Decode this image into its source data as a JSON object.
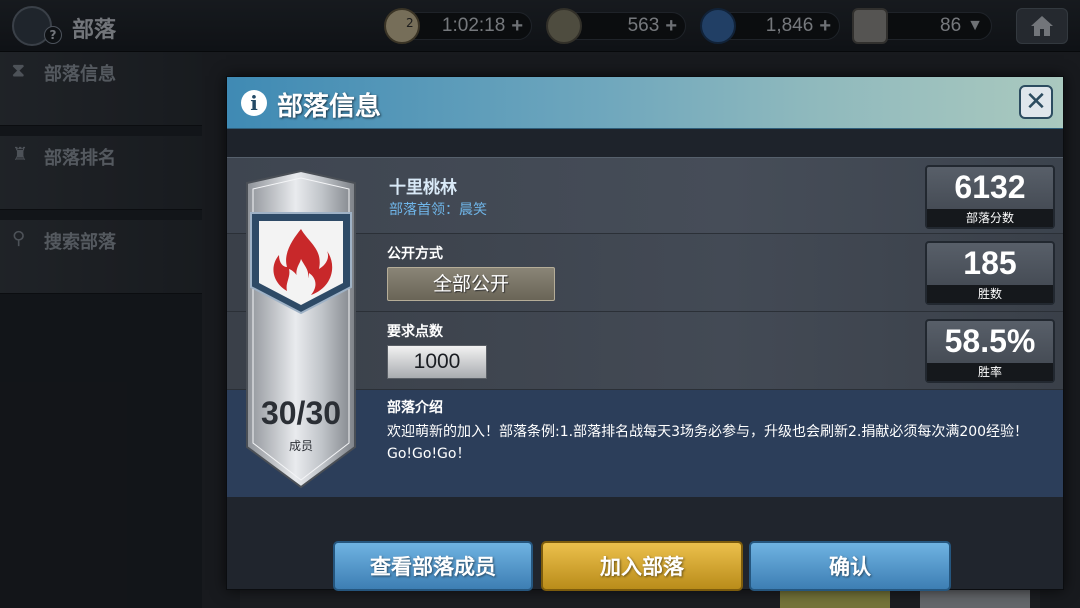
{
  "topbar": {
    "title": "部落",
    "emblem_badge": "?",
    "timer_count": "2",
    "timer": "1:02:18",
    "coins": "563",
    "gems": "1,846",
    "trophies": "86",
    "plus": "+",
    "dropdown": "▼",
    "home_icon": "house-icon"
  },
  "sidebar": {
    "items": [
      {
        "label": "部落信息",
        "icon": "hourglass-icon"
      },
      {
        "label": "部落排名",
        "icon": "ranking-icon"
      },
      {
        "label": "搜索部落",
        "icon": "search-icon"
      }
    ]
  },
  "modal": {
    "title": "部落信息",
    "info_icon": "i",
    "close_label": "✕",
    "clan_name": "十里桃林",
    "leader_label": "部落首领：晨笑",
    "open_mode_label": "公开方式",
    "open_mode_value": "全部公开",
    "required_points_label": "要求点数",
    "required_points_value": "1000",
    "intro_label": "部落介绍",
    "intro_text": "欢迎萌新的加入！部落条例:1.部落排名战每天3场务必参与，升级也会刷新2.捐献必须每次满200经验！Go!Go!Go！",
    "members": "30/30",
    "members_label": "成员",
    "stats": [
      {
        "value": "6132",
        "label": "部落分数"
      },
      {
        "value": "185",
        "label": "胜数"
      },
      {
        "value": "58.5%",
        "label": "胜率"
      }
    ],
    "buttons": {
      "view_members": "查看部落成员",
      "join": "加入部落",
      "confirm": "确认"
    }
  },
  "colors": {
    "header_accent": "#3f8ab4",
    "button_blue": "#4f93c8",
    "button_gold": "#d6a935",
    "flame_red": "#c8282a"
  }
}
